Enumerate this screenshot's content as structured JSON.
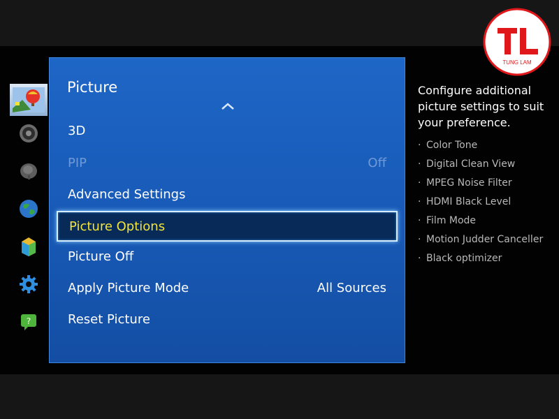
{
  "menu": {
    "title": "Picture",
    "items": [
      {
        "label": "3D",
        "value": ""
      },
      {
        "label": "PIP",
        "value": "Off"
      },
      {
        "label": "Advanced Settings",
        "value": ""
      },
      {
        "label": "Picture Options",
        "value": ""
      },
      {
        "label": "Picture Off",
        "value": ""
      },
      {
        "label": "Apply Picture Mode",
        "value": "All Sources"
      },
      {
        "label": "Reset Picture",
        "value": ""
      }
    ],
    "focused_item": "Picture Options",
    "disabled_item": "PIP"
  },
  "side_categories": [
    {
      "icon": "picture-icon",
      "selected": true
    },
    {
      "icon": "speaker-icon",
      "selected": false
    },
    {
      "icon": "broadcast-dish-icon",
      "selected": false
    },
    {
      "icon": "globe-icon",
      "selected": false
    },
    {
      "icon": "smart-hub-icon",
      "selected": false
    },
    {
      "icon": "gear-icon",
      "selected": false
    },
    {
      "icon": "support-icon",
      "selected": false
    }
  ],
  "help": {
    "description": "Configure additional picture settings to suit your preference.",
    "items": [
      "Color Tone",
      "Digital Clean View",
      "MPEG Noise Filter",
      "HDMI Black Level",
      "Film Mode",
      "Motion Judder Canceller",
      "Black optimizer"
    ]
  },
  "logo": {
    "letters": "TL",
    "text": "TUNG LAM",
    "color": "#e0181b"
  },
  "colors": {
    "panel": "#1a5ebd",
    "focus_fill": "#072a58",
    "focus_text": "#f3e43a",
    "disabled_text": "#6f9ad6"
  }
}
